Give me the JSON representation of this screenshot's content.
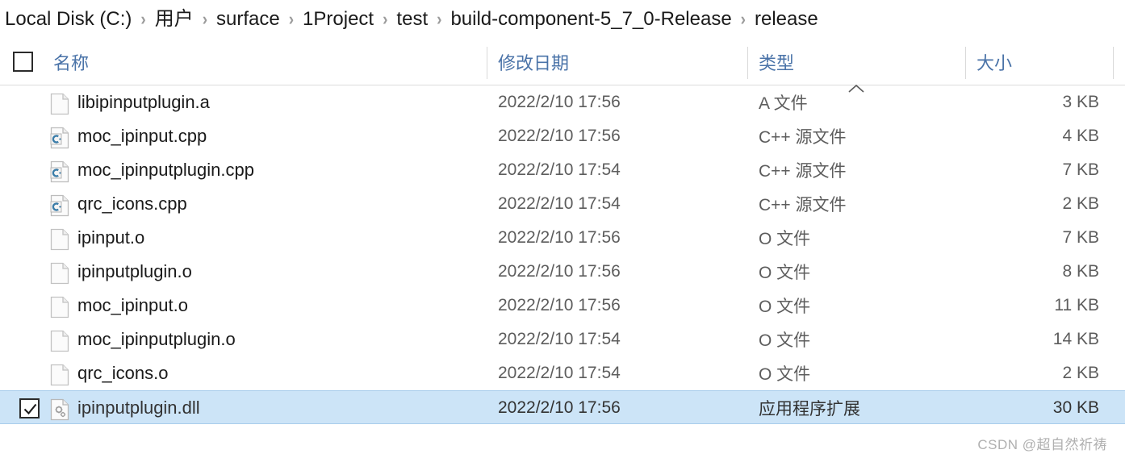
{
  "breadcrumb": {
    "separator": "›",
    "items": [
      {
        "label": "Local Disk (C:)"
      },
      {
        "label": "用户"
      },
      {
        "label": "surface"
      },
      {
        "label": "1Project"
      },
      {
        "label": "test"
      },
      {
        "label": "build-component-5_7_0-Release"
      },
      {
        "label": "release"
      }
    ]
  },
  "columns": {
    "name": "名称",
    "date": "修改日期",
    "type": "类型",
    "size": "大小",
    "sort_column": "类型",
    "sort_direction": "ascending",
    "select_all_checked": false
  },
  "files": [
    {
      "name": "libipinputplugin.a",
      "date": "2022/2/10 17:56",
      "type": "A 文件",
      "size": "3 KB",
      "icon": "generic-file-icon",
      "selected": false,
      "checked": false
    },
    {
      "name": "moc_ipinput.cpp",
      "date": "2022/2/10 17:56",
      "type": "C++ 源文件",
      "size": "4 KB",
      "icon": "cpp-source-file-icon",
      "selected": false,
      "checked": false
    },
    {
      "name": "moc_ipinputplugin.cpp",
      "date": "2022/2/10 17:54",
      "type": "C++ 源文件",
      "size": "7 KB",
      "icon": "cpp-source-file-icon",
      "selected": false,
      "checked": false
    },
    {
      "name": "qrc_icons.cpp",
      "date": "2022/2/10 17:54",
      "type": "C++ 源文件",
      "size": "2 KB",
      "icon": "cpp-source-file-icon",
      "selected": false,
      "checked": false
    },
    {
      "name": "ipinput.o",
      "date": "2022/2/10 17:56",
      "type": "O 文件",
      "size": "7 KB",
      "icon": "generic-file-icon",
      "selected": false,
      "checked": false
    },
    {
      "name": "ipinputplugin.o",
      "date": "2022/2/10 17:56",
      "type": "O 文件",
      "size": "8 KB",
      "icon": "generic-file-icon",
      "selected": false,
      "checked": false
    },
    {
      "name": "moc_ipinput.o",
      "date": "2022/2/10 17:56",
      "type": "O 文件",
      "size": "11 KB",
      "icon": "generic-file-icon",
      "selected": false,
      "checked": false
    },
    {
      "name": "moc_ipinputplugin.o",
      "date": "2022/2/10 17:54",
      "type": "O 文件",
      "size": "14 KB",
      "icon": "generic-file-icon",
      "selected": false,
      "checked": false
    },
    {
      "name": "qrc_icons.o",
      "date": "2022/2/10 17:54",
      "type": "O 文件",
      "size": "2 KB",
      "icon": "generic-file-icon",
      "selected": false,
      "checked": false
    },
    {
      "name": "ipinputplugin.dll",
      "date": "2022/2/10 17:56",
      "type": "应用程序扩展",
      "size": "30 KB",
      "icon": "dll-file-icon",
      "selected": true,
      "checked": true
    }
  ],
  "watermark": "CSDN @超自然祈祷",
  "colors": {
    "header_text": "#4a73a8",
    "selection_fill": "#cce4f7",
    "selection_border": "#a9cdec",
    "value_text": "#5d5d5d",
    "cpp_icon_blue": "#3a7ca8"
  }
}
